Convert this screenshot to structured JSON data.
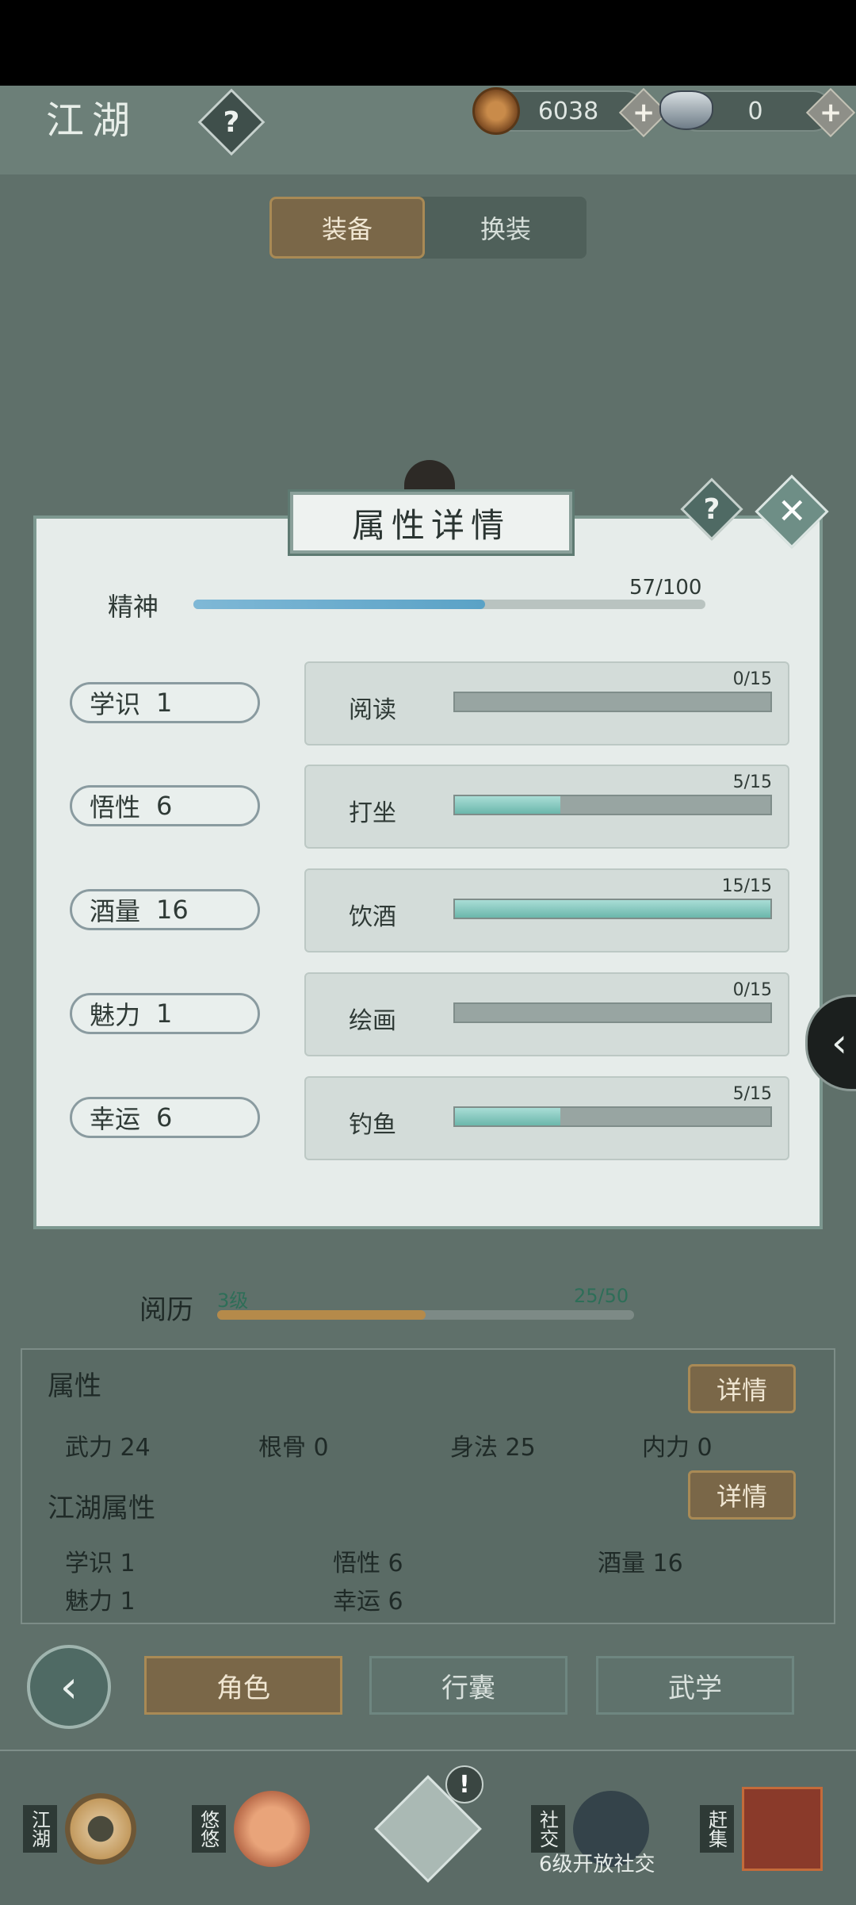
{
  "header": {
    "title": "江湖",
    "help_symbol": "?",
    "coins": "6038",
    "ingots": "0",
    "plus_symbol": "+"
  },
  "tabs": [
    {
      "label": "装备",
      "active": true
    },
    {
      "label": "换装",
      "active": false
    }
  ],
  "modal": {
    "title": "属性详情",
    "help_symbol": "?",
    "close_symbol": "✕",
    "spirit": {
      "label": "精神",
      "value": "57/100",
      "current": 57,
      "max": 100
    },
    "attributes": [
      {
        "name": "学识",
        "value": "1"
      },
      {
        "name": "悟性",
        "value": "6"
      },
      {
        "name": "酒量",
        "value": "16"
      },
      {
        "name": "魅力",
        "value": "1"
      },
      {
        "name": "幸运",
        "value": "6"
      }
    ],
    "skills": [
      {
        "name": "阅读",
        "progress": "0/15",
        "fraction": 0.0
      },
      {
        "name": "打坐",
        "progress": "5/15",
        "fraction": 0.333
      },
      {
        "name": "饮酒",
        "progress": "15/15",
        "fraction": 1.0
      },
      {
        "name": "绘画",
        "progress": "0/15",
        "fraction": 0.0
      },
      {
        "name": "钓鱼",
        "progress": "5/15",
        "fraction": 0.333
      }
    ]
  },
  "experience": {
    "label": "阅历",
    "level": "3级",
    "value": "25/50",
    "fraction": 0.5
  },
  "attributes_panel": {
    "title": "属性",
    "detail_label": "详情",
    "items": [
      "武力 24",
      "根骨 0",
      "身法 25",
      "内力 0"
    ],
    "jianghu_title": "江湖属性",
    "jianghu_detail_label": "详情",
    "jianghu_items": [
      "学识 1",
      "悟性 6",
      "酒量 16",
      "魅力 1",
      "幸运 6"
    ]
  },
  "bottom_tabs": [
    {
      "label": "角色",
      "active": true
    },
    {
      "label": "行囊",
      "active": false
    },
    {
      "label": "武学",
      "active": false
    }
  ],
  "dock": {
    "items": [
      "江湖",
      "悠悠",
      "",
      "社交",
      "赶集"
    ],
    "social_note": "6级开放社交",
    "alert_symbol": "!"
  },
  "colors": {
    "accent_gold": "#7a6748",
    "progress_teal": "#6bb7ab",
    "spirit_blue": "#5aa2c6",
    "background": "#5f706a"
  },
  "icons": {
    "back": "chevron-left-icon",
    "side": "chevron-left-icon"
  }
}
